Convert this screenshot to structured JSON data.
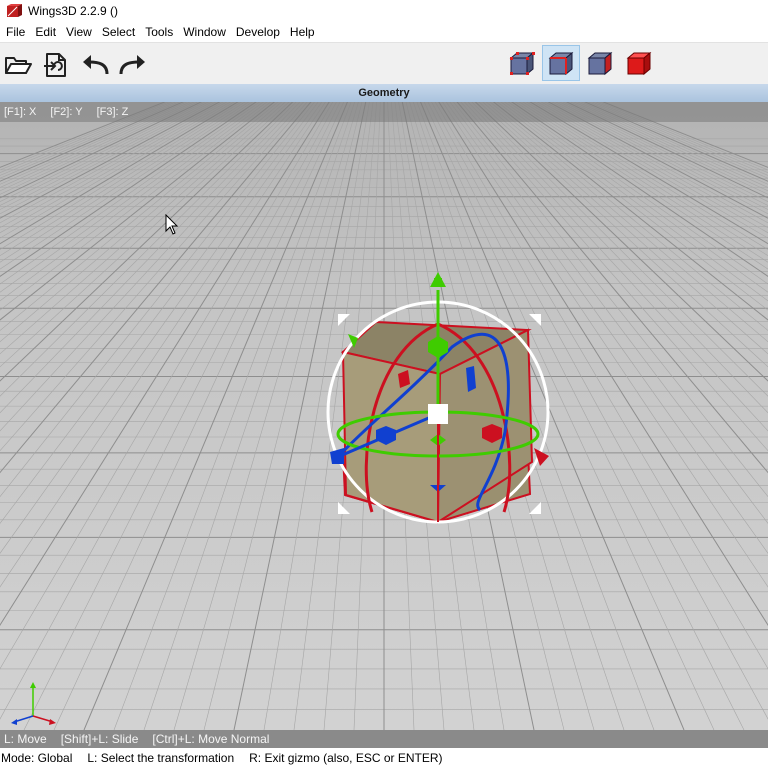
{
  "window": {
    "title": "Wings3D 2.2.9 ()"
  },
  "menu": {
    "items": [
      {
        "label": "File"
      },
      {
        "label": "Edit"
      },
      {
        "label": "View"
      },
      {
        "label": "Select"
      },
      {
        "label": "Tools"
      },
      {
        "label": "Window"
      },
      {
        "label": "Develop"
      },
      {
        "label": "Help"
      }
    ]
  },
  "toolbar": {
    "buttons": [
      {
        "icon": "open-folder-icon"
      },
      {
        "icon": "save-icon"
      },
      {
        "icon": "undo-icon"
      },
      {
        "icon": "redo-icon"
      }
    ],
    "selection_modes": [
      {
        "icon": "vertex-mode-icon",
        "active": false
      },
      {
        "icon": "edge-mode-icon",
        "active": true
      },
      {
        "icon": "face-mode-icon",
        "active": false
      },
      {
        "icon": "body-mode-icon",
        "active": false
      }
    ]
  },
  "viewport": {
    "header": "Geometry",
    "axis_hints": [
      "[F1]: X",
      "[F2]: Y",
      "[F3]: Z"
    ]
  },
  "status": {
    "hints": [
      "L: Move",
      "[Shift]+L: Slide",
      "[Ctrl]+L: Move Normal"
    ]
  },
  "info": {
    "hints": [
      "Mode: Global",
      "L: Select the transformation",
      "R: Exit gizmo (also, ESC or ENTER)"
    ]
  },
  "colors": {
    "x_axis": "#cc1020",
    "y_axis": "#3fcc00",
    "z_axis": "#1040d0",
    "cube_face": "#a89c78",
    "header_bg": "#b7cde6"
  }
}
